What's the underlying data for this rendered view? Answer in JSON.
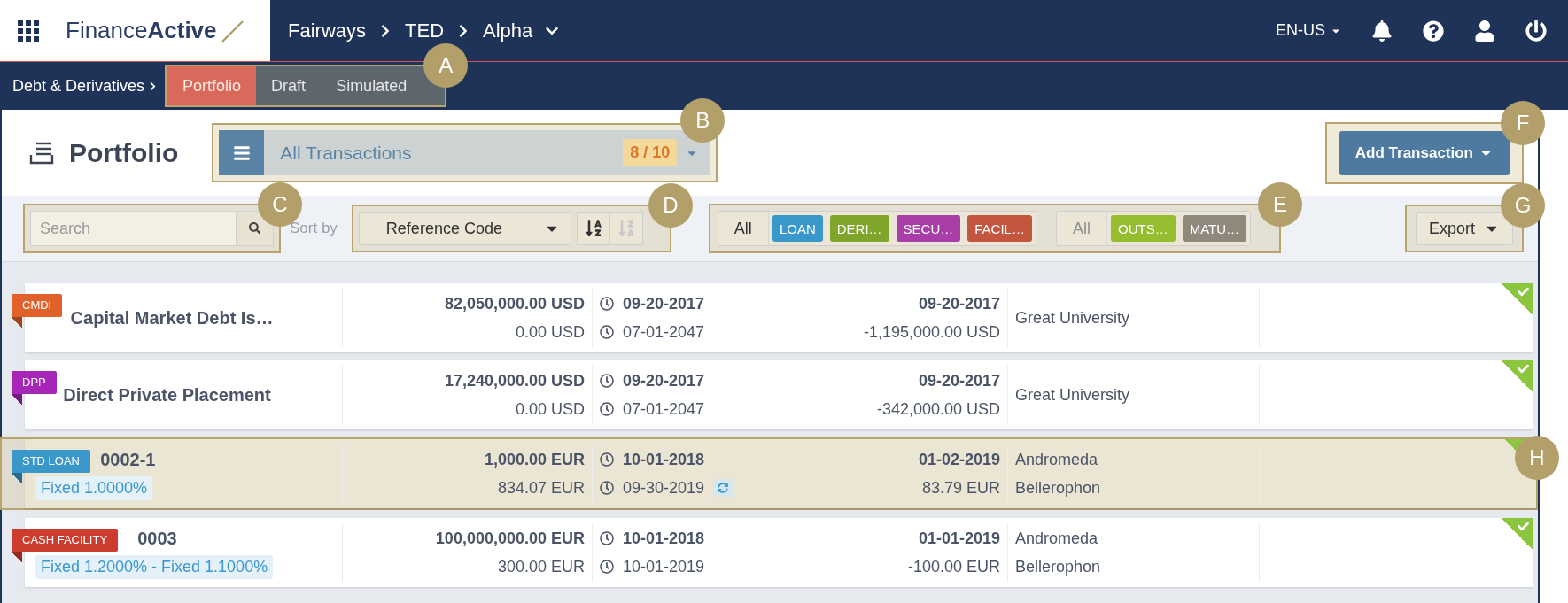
{
  "topbar": {
    "logo": {
      "light": "Finance",
      "bold": "Active"
    },
    "breadcrumb": [
      "Fairways",
      "TED",
      "Alpha"
    ],
    "language": "EN-US"
  },
  "subnav": {
    "section": "Debt & Derivatives",
    "callout": "A",
    "tabs": [
      {
        "label": "Portfolio",
        "selected": true
      },
      {
        "label": "Draft",
        "selected": false
      },
      {
        "label": "Simulated",
        "selected": false
      }
    ]
  },
  "header": {
    "title": "Portfolio",
    "view": {
      "label": "All Transactions",
      "count": "8 / 10",
      "callout": "B"
    },
    "add_button": {
      "label": "Add Transaction",
      "callout": "F"
    }
  },
  "toolbar": {
    "search": {
      "placeholder": "Search",
      "callout": "C"
    },
    "sort": {
      "label": "Sort by",
      "field": "Reference Code",
      "callout": "D",
      "orders": [
        {
          "kind": "ascending",
          "selected": true
        },
        {
          "kind": "descending",
          "selected": false
        }
      ]
    },
    "filters": {
      "callout": "E",
      "types": [
        {
          "kind": "all",
          "label": "All",
          "disabled": false
        },
        {
          "kind": "chip",
          "label": "LOAN",
          "color": "#3a97c9",
          "selected": true
        },
        {
          "kind": "chip",
          "label": "DERI…",
          "color": "#7fa52a",
          "selected": true
        },
        {
          "kind": "chip",
          "label": "SECU…",
          "color": "#a93ea8",
          "selected": true
        },
        {
          "kind": "chip",
          "label": "FACIL…",
          "color": "#c4553f",
          "selected": true
        }
      ],
      "statuses": [
        {
          "kind": "all",
          "label": "All",
          "disabled": true
        },
        {
          "kind": "chip",
          "label": "OUTS…",
          "color": "#94bd2f",
          "selected": true
        },
        {
          "kind": "chip",
          "label": "MATU…",
          "selected": false
        }
      ]
    },
    "export": {
      "label": "Export",
      "callout": "G"
    }
  },
  "transactions": [
    {
      "tag": "CMDI",
      "color": "#e0622a",
      "name": "Capital Market Debt Is…",
      "amount": "82,050,000.00 USD",
      "outstanding": "0.00 USD",
      "start_date": "09-20-2017",
      "end_date": "07-01-2047",
      "refresh": false,
      "next_date": "09-20-2017",
      "next_amount": "-1,195,000.00 USD",
      "lender": "Great University",
      "validated": true
    },
    {
      "tag": "DPP",
      "color": "#a626b8",
      "name": "Direct Private Placement",
      "amount": "17,240,000.00 USD",
      "outstanding": "0.00 USD",
      "start_date": "09-20-2017",
      "end_date": "07-01-2047",
      "refresh": false,
      "next_date": "09-20-2017",
      "next_amount": "-342,000.00 USD",
      "lender": "Great University",
      "validated": true
    },
    {
      "tag": "STD LOAN",
      "color": "#3a97c9",
      "name": "0002-1",
      "rate": "Fixed 1.0000%",
      "amount": "1,000.00 EUR",
      "outstanding": "834.07 EUR",
      "start_date": "10-01-2018",
      "end_date": "09-30-2019",
      "refresh": true,
      "next_date": "01-02-2019",
      "next_amount": "83.79 EUR",
      "lender": "Andromeda",
      "counterparty": "Bellerophon",
      "validated": true,
      "callout": "H"
    },
    {
      "tag": "CASH FACILITY",
      "color": "#cc3d30",
      "name": "0003",
      "rate": "Fixed 1.2000% - Fixed 1.1000%",
      "amount": "100,000,000.00 EUR",
      "outstanding": "300.00 EUR",
      "start_date": "10-01-2018",
      "end_date": "10-01-2019",
      "refresh": false,
      "next_date": "01-01-2019",
      "next_amount": "-100.00 EUR",
      "lender": "Andromeda",
      "counterparty": "Bellerophon",
      "validated": true
    }
  ]
}
